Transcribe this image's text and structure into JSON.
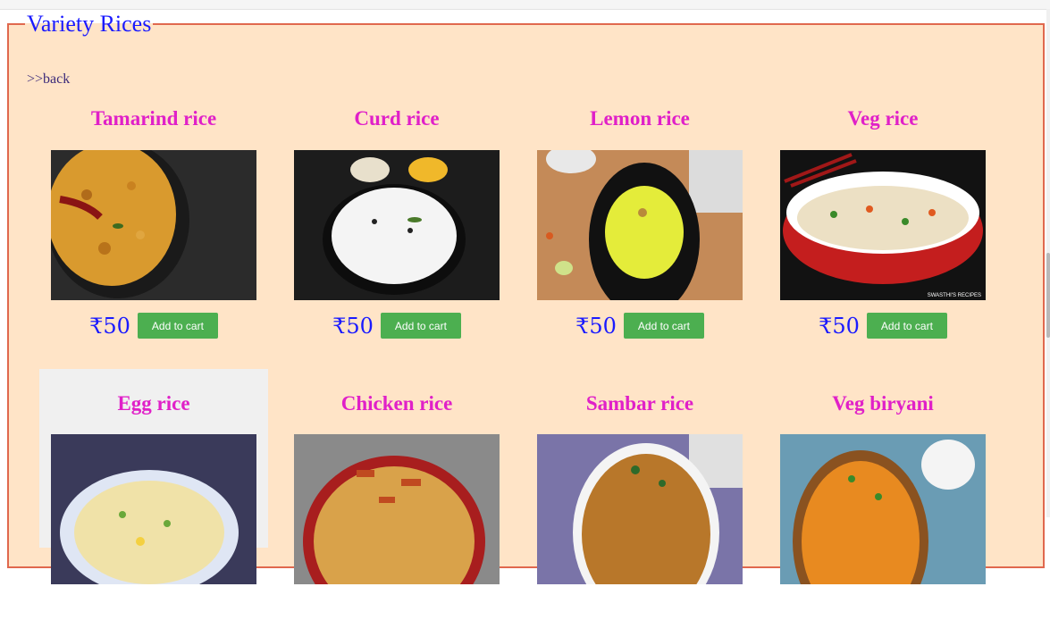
{
  "section": {
    "legend": "Variety Rices",
    "back_label": ">>back"
  },
  "items": [
    {
      "name": "Tamarind rice",
      "price": "₹50",
      "button": "Add to cart"
    },
    {
      "name": "Curd rice",
      "price": "₹50",
      "button": "Add to cart"
    },
    {
      "name": "Lemon rice",
      "price": "₹50",
      "button": "Add to cart"
    },
    {
      "name": "Veg rice",
      "price": "₹50",
      "button": "Add to cart"
    },
    {
      "name": "Egg rice",
      "price": "",
      "button": ""
    },
    {
      "name": "Chicken rice",
      "price": "",
      "button": ""
    },
    {
      "name": "Sambar rice",
      "price": "",
      "button": ""
    },
    {
      "name": "Veg biryani",
      "price": "",
      "button": ""
    }
  ],
  "image_watermark": "SWASTHI'S RECIPES",
  "colors": {
    "section_bg": "#ffe4c7",
    "section_border": "#e0684e",
    "legend": "#1a1aff",
    "title": "#e020c8",
    "price": "#1a1aff",
    "button_bg": "#4caf50"
  }
}
